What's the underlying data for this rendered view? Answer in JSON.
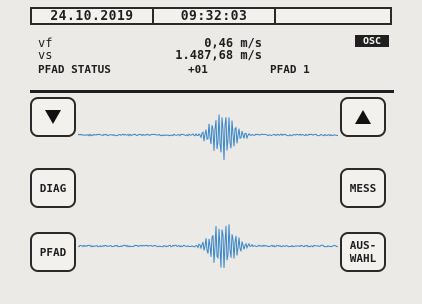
{
  "status_bar": {
    "date": "24.10.2019",
    "time": "09:32:03",
    "extra": ""
  },
  "readouts": {
    "vf_label": "vf",
    "vf_value": "0,46 m/s",
    "vs_label": "vs",
    "vs_value": "1.487,68 m/s",
    "pfad_status_label": "PFAD STATUS",
    "pfad_status_value": "+01",
    "pfad_name": "PFAD 1"
  },
  "mode_badge": "OSC",
  "buttons": {
    "down_icon": "triangle-down-icon",
    "up_icon": "triangle-up-icon",
    "diag": "DIAG",
    "mess": "MESS",
    "pfad": "PFAD",
    "auswahl_line1": "AUS-",
    "auswahl_line2": "WAHL"
  },
  "colors": {
    "screen_bg": "#ebeae6",
    "waveform": "#3a86c8",
    "text": "#1e1e1e",
    "badge_bg": "#1f1f1f"
  }
}
